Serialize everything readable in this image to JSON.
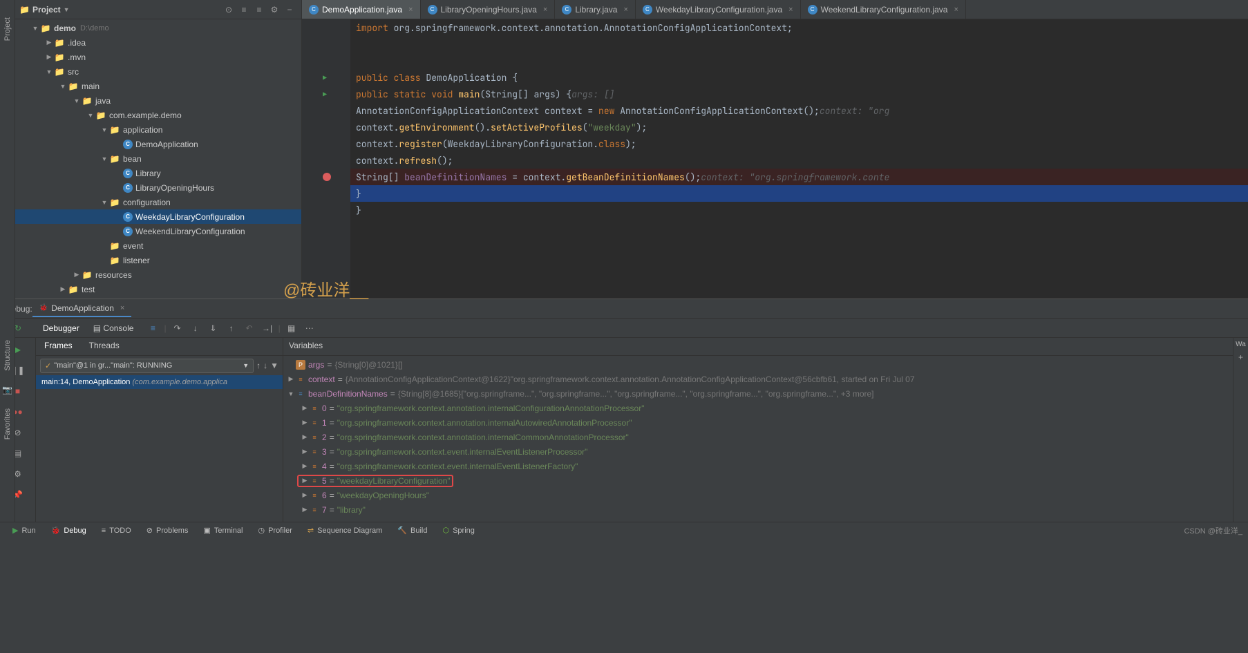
{
  "leftRail": {
    "project": "Project"
  },
  "projectPanel": {
    "title": "Project",
    "tree": {
      "root": {
        "name": "demo",
        "path": "D:\\demo"
      },
      "idea": ".idea",
      "mvn": ".mvn",
      "src": "src",
      "main": "main",
      "java": "java",
      "pkg": "com.example.demo",
      "application": "application",
      "demoApp": "DemoApplication",
      "bean": "bean",
      "library": "Library",
      "libraryOpeningHours": "LibraryOpeningHours",
      "configuration": "configuration",
      "weekdayConfig": "WeekdayLibraryConfiguration",
      "weekendConfig": "WeekendLibraryConfiguration",
      "event": "event",
      "listener": "listener",
      "resources": "resources",
      "test": "test"
    }
  },
  "editor": {
    "tabs": {
      "t1": "DemoApplication.java",
      "t2": "LibraryOpeningHours.java",
      "t3": "Library.java",
      "t4": "WeekdayLibraryConfiguration.java",
      "t5": "WeekendLibraryConfiguration.java"
    },
    "code": {
      "import": "import ",
      "importPkg": "org.springframework.context.annotation.AnnotationConfigApplicationContext",
      "public": "public ",
      "class": "class ",
      "demoClass": "DemoApplication ",
      "static": "static ",
      "void": "void ",
      "main": "main",
      "stringArr": "String[] args",
      "hintArgs": "args: []",
      "ctxType": "AnnotationConfigApplicationContext ",
      "ctxVar": "context ",
      "new": "new ",
      "ctxCtor": "AnnotationConfigApplicationContext()",
      "hintCtx": "context: \"org",
      "getEnv": "getEnvironment",
      "setProfiles": "setActiveProfiles",
      "weekday": "\"weekday\"",
      "register": "register",
      "weekdayClass": "WeekdayLibraryConfiguration",
      "classRef": "class",
      "refresh": "refresh",
      "beanNames": "beanDefinitionNames ",
      "getBeanNames": "getBeanDefinitionNames",
      "hintBean": "context: \"org.springframework.conte"
    }
  },
  "watermark": "@砖业洋__",
  "debug": {
    "label": "Debug:",
    "appName": "DemoApplication",
    "debugger": "Debugger",
    "console": "Console",
    "frames": "Frames",
    "threads": "Threads",
    "variables": "Variables",
    "watches": "Wa",
    "threadName": "\"main\"@1 in gr...\"main\": RUNNING",
    "frameItem": "main:14, DemoApplication ",
    "framePkg": "(com.example.demo.applica",
    "vars": {
      "args": {
        "name": "args",
        "type": "{String[0]@1021}",
        "val": "[]"
      },
      "context": {
        "name": "context",
        "type": "{AnnotationConfigApplicationContext@1622}",
        "val": "\"org.springframework.context.annotation.AnnotationConfigApplicationContext@56cbfb61, started on Fri Jul 07"
      },
      "beanDef": {
        "name": "beanDefinitionNames",
        "type": "{String[8]@1685}",
        "val": "[\"org.springframe...\", \"org.springframe...\", \"org.springframe...\", \"org.springframe...\", \"org.springframe...\", +3 more]"
      },
      "items": [
        {
          "idx": "0",
          "val": "\"org.springframework.context.annotation.internalConfigurationAnnotationProcessor\""
        },
        {
          "idx": "1",
          "val": "\"org.springframework.context.annotation.internalAutowiredAnnotationProcessor\""
        },
        {
          "idx": "2",
          "val": "\"org.springframework.context.annotation.internalCommonAnnotationProcessor\""
        },
        {
          "idx": "3",
          "val": "\"org.springframework.context.event.internalEventListenerProcessor\""
        },
        {
          "idx": "4",
          "val": "\"org.springframework.context.event.internalEventListenerFactory\""
        },
        {
          "idx": "5",
          "val": "\"weekdayLibraryConfiguration\""
        },
        {
          "idx": "6",
          "val": "\"weekdayOpeningHours\""
        },
        {
          "idx": "7",
          "val": "\"library\""
        }
      ]
    }
  },
  "bottomBar": {
    "run": "Run",
    "debug": "Debug",
    "todo": "TODO",
    "problems": "Problems",
    "terminal": "Terminal",
    "profiler": "Profiler",
    "sequence": "Sequence Diagram",
    "build": "Build",
    "spring": "Spring",
    "csdn": "CSDN @砖业洋_"
  },
  "farLeft": {
    "structure": "Structure",
    "favorites": "Favorites"
  }
}
